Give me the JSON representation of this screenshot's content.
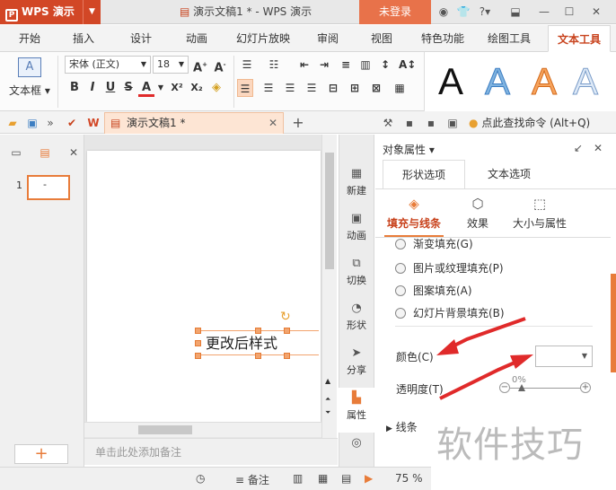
{
  "titlebar": {
    "app_name": "WPS 演示",
    "doc_title": "演示文稿1 * - WPS 演示",
    "login_label": "未登录",
    "help_label": "?"
  },
  "menu": {
    "tabs": [
      "开始",
      "插入",
      "设计",
      "动画",
      "幻灯片放映",
      "审阅",
      "视图",
      "特色功能",
      "绘图工具",
      "文本工具"
    ],
    "active_index": 9
  },
  "ribbon": {
    "textbox_label": "文本框",
    "font_name": "宋体 (正文)",
    "font_size": "18",
    "bold": "B",
    "italic": "I",
    "underline": "U",
    "strike": "S",
    "color_a": "A",
    "superscript": "X²",
    "subscript": "X₂",
    "art_letter": "A"
  },
  "quickbar": {
    "doc_tab": "演示文稿1 *",
    "find_command": "点此查找命令 (Alt+Q)"
  },
  "slides": {
    "number": "1",
    "thumb_text": "-",
    "notes_placeholder": "单击此处添加备注"
  },
  "textbox": {
    "text": "更改后样式"
  },
  "tools": [
    {
      "label": "新建",
      "icon": "new-icon"
    },
    {
      "label": "动画",
      "icon": "animation-icon"
    },
    {
      "label": "切换",
      "icon": "transition-icon"
    },
    {
      "label": "形状",
      "icon": "shape-icon"
    },
    {
      "label": "分享",
      "icon": "share-icon"
    },
    {
      "label": "属性",
      "icon": "properties-icon"
    }
  ],
  "props": {
    "title": "对象属性",
    "tab_shape": "形状选项",
    "tab_text": "文本选项",
    "sub_fill": "填充与线条",
    "sub_effect": "效果",
    "sub_size": "大小与属性",
    "fill_options": [
      "渐变填充(G)",
      "图片或纹理填充(P)",
      "图案填充(A)",
      "幻灯片背景填充(B)"
    ],
    "color_label": "颜色(C)",
    "transparency_label": "透明度(T)",
    "transparency_value": "0%",
    "line_label": "线条"
  },
  "statusbar": {
    "notes_label": "备注",
    "zoom": "75 %"
  },
  "watermark": "软件技巧",
  "colors": {
    "accent": "#d24726",
    "handle": "#f2a46e",
    "arrow": "#e02a2a"
  }
}
